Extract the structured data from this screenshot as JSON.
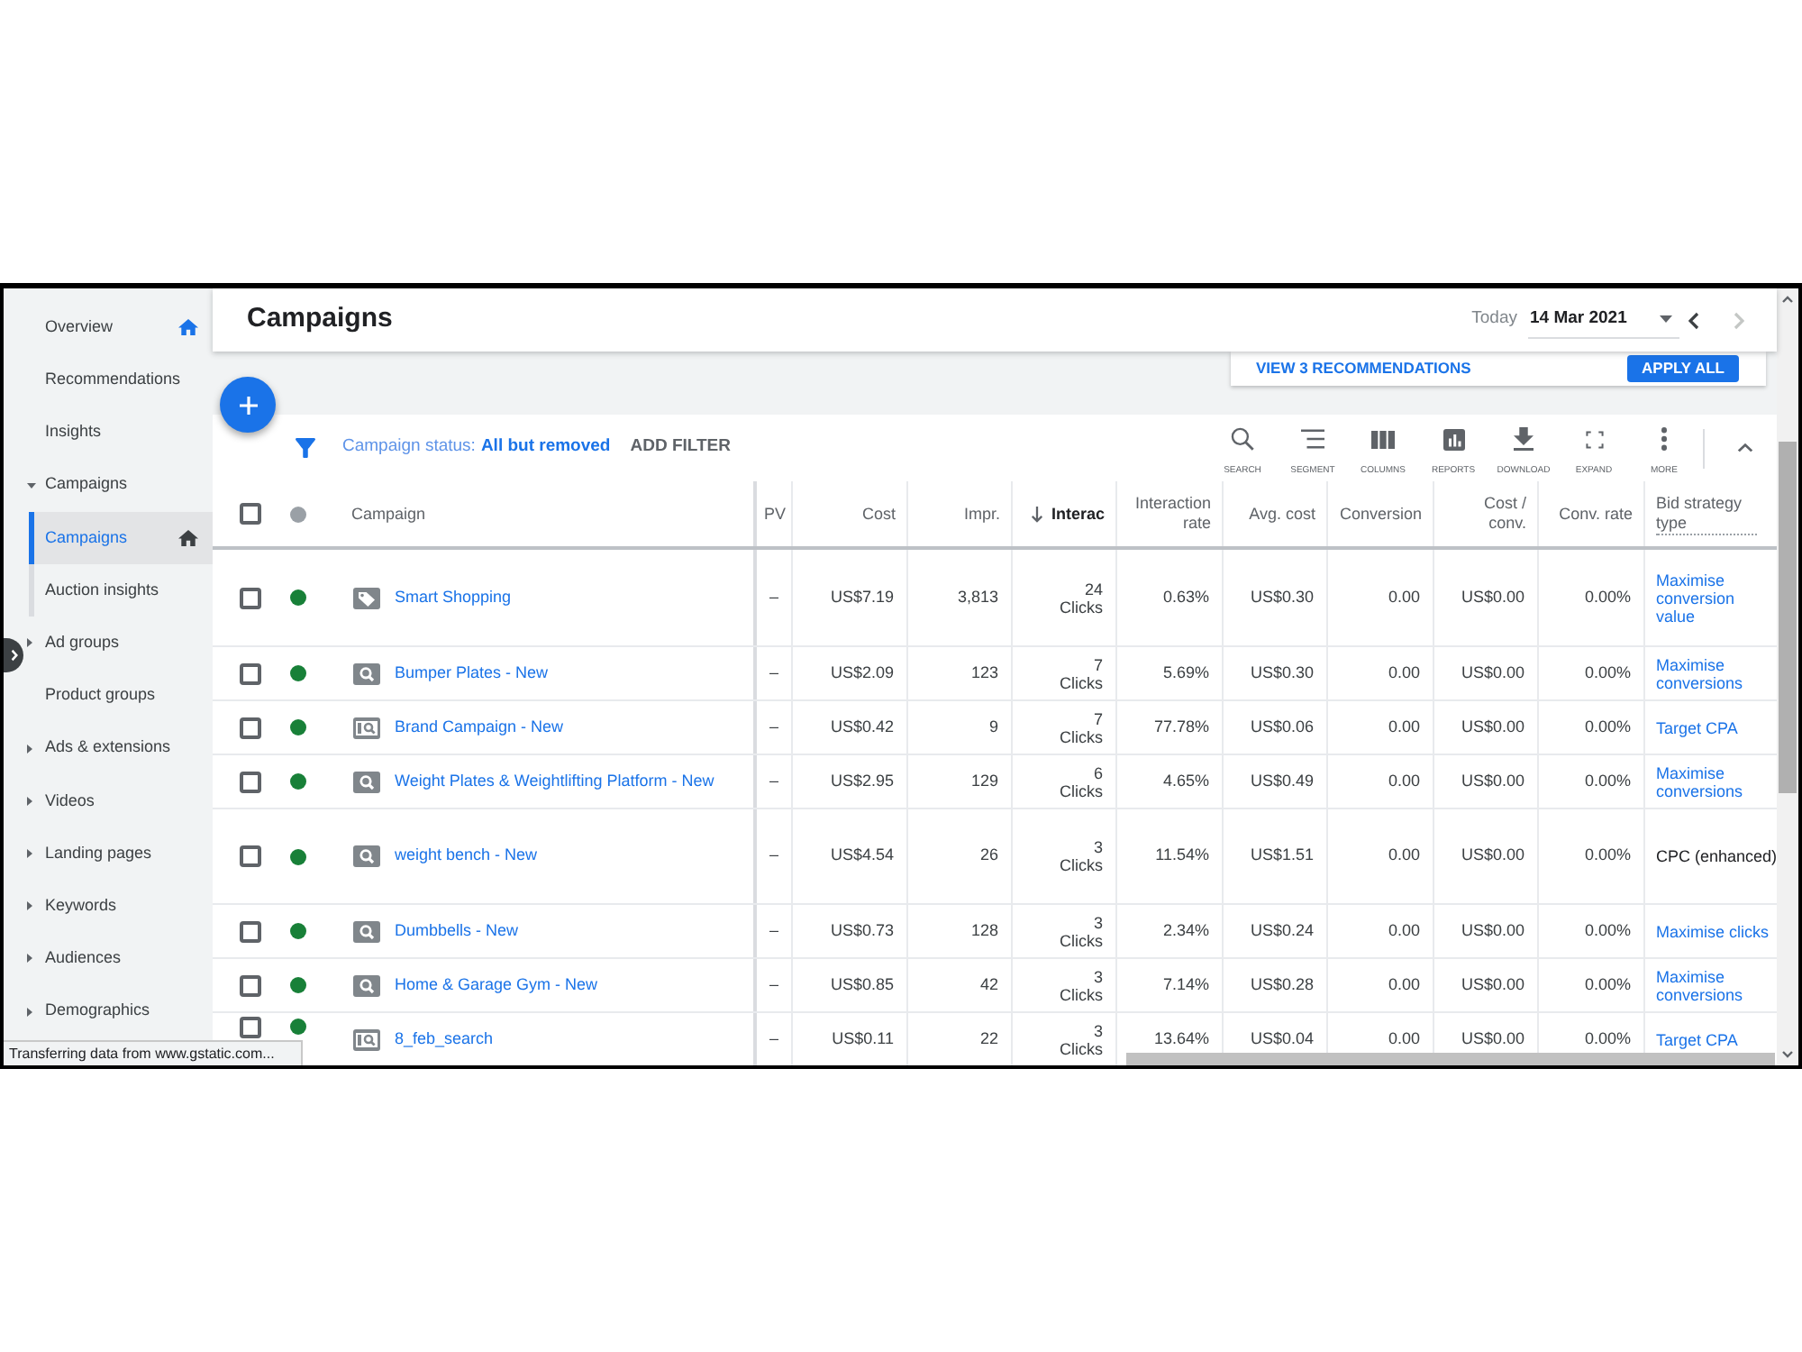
{
  "sidebar": {
    "items": [
      {
        "label": "Overview",
        "kind": "page",
        "selected": false,
        "home": true
      },
      {
        "label": "Recommendations",
        "kind": "page",
        "selected": false,
        "home": false
      },
      {
        "label": "Insights",
        "kind": "page",
        "selected": false,
        "home": false
      },
      {
        "label": "Campaigns",
        "kind": "group",
        "expanded": true,
        "selected": false,
        "home": false,
        "children": [
          {
            "label": "Campaigns",
            "selected": true,
            "home": true
          },
          {
            "label": "Auction insights",
            "selected": false,
            "home": false
          }
        ]
      },
      {
        "label": "Ad groups",
        "kind": "group",
        "expanded": false,
        "selected": false,
        "home": false
      },
      {
        "label": "Product groups",
        "kind": "page",
        "selected": false,
        "home": false
      },
      {
        "label": "Ads & extensions",
        "kind": "group",
        "expanded": false,
        "selected": false,
        "home": false
      },
      {
        "label": "Videos",
        "kind": "group",
        "expanded": false,
        "selected": false,
        "home": false
      },
      {
        "label": "Landing pages",
        "kind": "group",
        "expanded": false,
        "selected": false,
        "home": false
      },
      {
        "label": "Keywords",
        "kind": "group",
        "expanded": false,
        "selected": false,
        "home": false
      },
      {
        "label": "Audiences",
        "kind": "group",
        "expanded": false,
        "selected": false,
        "home": false
      },
      {
        "label": "Demographics",
        "kind": "group",
        "expanded": false,
        "selected": false,
        "home": false
      }
    ]
  },
  "header": {
    "title": "Campaigns",
    "date": {
      "label": "Today",
      "value": "14 Mar 2021",
      "prev_disabled": false,
      "next_disabled": true
    }
  },
  "recommendations": {
    "link": "VIEW 3 RECOMMENDATIONS",
    "button": "APPLY ALL"
  },
  "toolbar": {
    "filter": {
      "label": "Campaign status:",
      "value": "All but removed"
    },
    "add_filter": "ADD FILTER",
    "tools": [
      {
        "kind": "search",
        "label": "SEARCH"
      },
      {
        "kind": "segment",
        "label": "SEGMENT"
      },
      {
        "kind": "columns",
        "label": "COLUMNS"
      },
      {
        "kind": "reports",
        "label": "REPORTS"
      },
      {
        "kind": "download",
        "label": "DOWNLOAD"
      },
      {
        "kind": "expand",
        "label": "EXPAND"
      },
      {
        "kind": "more",
        "label": "MORE"
      }
    ]
  },
  "table": {
    "select_all_checked": false,
    "columns": [
      {
        "label": "Campaign",
        "sorted": false
      },
      {
        "label": "PV",
        "sorted": false
      },
      {
        "label": "Cost",
        "sorted": false
      },
      {
        "label": "Impr.",
        "sorted": false
      },
      {
        "label": "Interac",
        "sorted": true
      },
      {
        "label": "Interaction rate",
        "sorted": false
      },
      {
        "label": "Avg. cost",
        "sorted": false
      },
      {
        "label": "Conversion",
        "sorted": false
      },
      {
        "label": "Cost / conv.",
        "sorted": false
      },
      {
        "label": "Conv. rate",
        "sorted": false
      },
      {
        "label": "Bid strategy type",
        "sorted": false
      }
    ],
    "rows": [
      {
        "checked": false,
        "enabled": true,
        "kind": "shopping",
        "name": "Smart Shopping",
        "pv": "–",
        "cost": "US$7.19",
        "impressions": "3,813",
        "interactions": "24",
        "interaction_type": "Clicks",
        "interaction_rate": "0.63%",
        "avg_cost": "US$0.30",
        "conversions": "0.00",
        "cost_per_conv": "US$0.00",
        "conv_rate": "0.00%",
        "bid_strategy": "Maximise conversion value",
        "bid_strategy_link": true
      },
      {
        "checked": false,
        "enabled": true,
        "kind": "search",
        "name": "Bumper Plates - New",
        "pv": "–",
        "cost": "US$2.09",
        "impressions": "123",
        "interactions": "7",
        "interaction_type": "Clicks",
        "interaction_rate": "5.69%",
        "avg_cost": "US$0.30",
        "conversions": "0.00",
        "cost_per_conv": "US$0.00",
        "conv_rate": "0.00%",
        "bid_strategy": "Maximise conversions",
        "bid_strategy_link": true
      },
      {
        "checked": false,
        "enabled": true,
        "kind": "dynamic_search",
        "name": "Brand Campaign - New",
        "pv": "–",
        "cost": "US$0.42",
        "impressions": "9",
        "interactions": "7",
        "interaction_type": "Clicks",
        "interaction_rate": "77.78%",
        "avg_cost": "US$0.06",
        "conversions": "0.00",
        "cost_per_conv": "US$0.00",
        "conv_rate": "0.00%",
        "bid_strategy": "Target CPA",
        "bid_strategy_link": true
      },
      {
        "checked": false,
        "enabled": true,
        "kind": "search",
        "name": "Weight Plates & Weightlifting Platform - New",
        "pv": "–",
        "cost": "US$2.95",
        "impressions": "129",
        "interactions": "6",
        "interaction_type": "Clicks",
        "interaction_rate": "4.65%",
        "avg_cost": "US$0.49",
        "conversions": "0.00",
        "cost_per_conv": "US$0.00",
        "conv_rate": "0.00%",
        "bid_strategy": "Maximise conversions",
        "bid_strategy_link": true
      },
      {
        "checked": false,
        "enabled": true,
        "kind": "search",
        "name": "weight bench - New",
        "pv": "–",
        "cost": "US$4.54",
        "impressions": "26",
        "interactions": "3",
        "interaction_type": "Clicks",
        "interaction_rate": "11.54%",
        "avg_cost": "US$1.51",
        "conversions": "0.00",
        "cost_per_conv": "US$0.00",
        "conv_rate": "0.00%",
        "bid_strategy": "CPC (enhanced)",
        "bid_strategy_link": false
      },
      {
        "checked": false,
        "enabled": true,
        "kind": "search",
        "name": "Dumbbells - New",
        "pv": "–",
        "cost": "US$0.73",
        "impressions": "128",
        "interactions": "3",
        "interaction_type": "Clicks",
        "interaction_rate": "2.34%",
        "avg_cost": "US$0.24",
        "conversions": "0.00",
        "cost_per_conv": "US$0.00",
        "conv_rate": "0.00%",
        "bid_strategy": "Maximise clicks",
        "bid_strategy_link": true
      },
      {
        "checked": false,
        "enabled": true,
        "kind": "search",
        "name": "Home & Garage Gym - New",
        "pv": "–",
        "cost": "US$0.85",
        "impressions": "42",
        "interactions": "3",
        "interaction_type": "Clicks",
        "interaction_rate": "7.14%",
        "avg_cost": "US$0.28",
        "conversions": "0.00",
        "cost_per_conv": "US$0.00",
        "conv_rate": "0.00%",
        "bid_strategy": "Maximise conversions",
        "bid_strategy_link": true
      },
      {
        "checked": false,
        "enabled": true,
        "kind": "dynamic_search",
        "name": "8_feb_search",
        "pv": "–",
        "cost": "US$0.11",
        "impressions": "22",
        "interactions": "3",
        "interaction_type": "Clicks",
        "interaction_rate": "13.64%",
        "avg_cost": "US$0.04",
        "conversions": "0.00",
        "cost_per_conv": "US$0.00",
        "conv_rate": "0.00%",
        "bid_strategy": "Target CPA",
        "bid_strategy_link": true
      }
    ]
  },
  "status_bar": {
    "text": "Transferring data from www.gstatic.com..."
  }
}
